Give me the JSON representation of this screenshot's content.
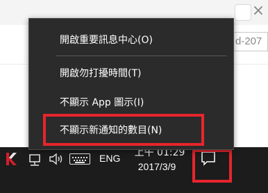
{
  "background": {
    "close_glyph": "×",
    "input_text": "d-207"
  },
  "context_menu": {
    "items": [
      {
        "label": "開啟重要訊息中心(O)"
      },
      {
        "label": "開啟勿打擾時間(T)"
      },
      {
        "label": "不顯示 App 圖示(I)"
      },
      {
        "label": "不顯示新通知的數目(N)"
      }
    ]
  },
  "taskbar": {
    "language": "ENG",
    "time": "上午 01:29",
    "date": "2017/3/9",
    "icons": [
      "kaspersky-icon",
      "network-icon",
      "volume-icon",
      "touch-keyboard-icon",
      "action-center-icon"
    ]
  },
  "colors": {
    "menu_bg": "#2b2b2b",
    "taskbar_bg": "#1c1c1c",
    "highlight_red": "#e8252d",
    "kaspersky_red": "#d21f2b"
  }
}
